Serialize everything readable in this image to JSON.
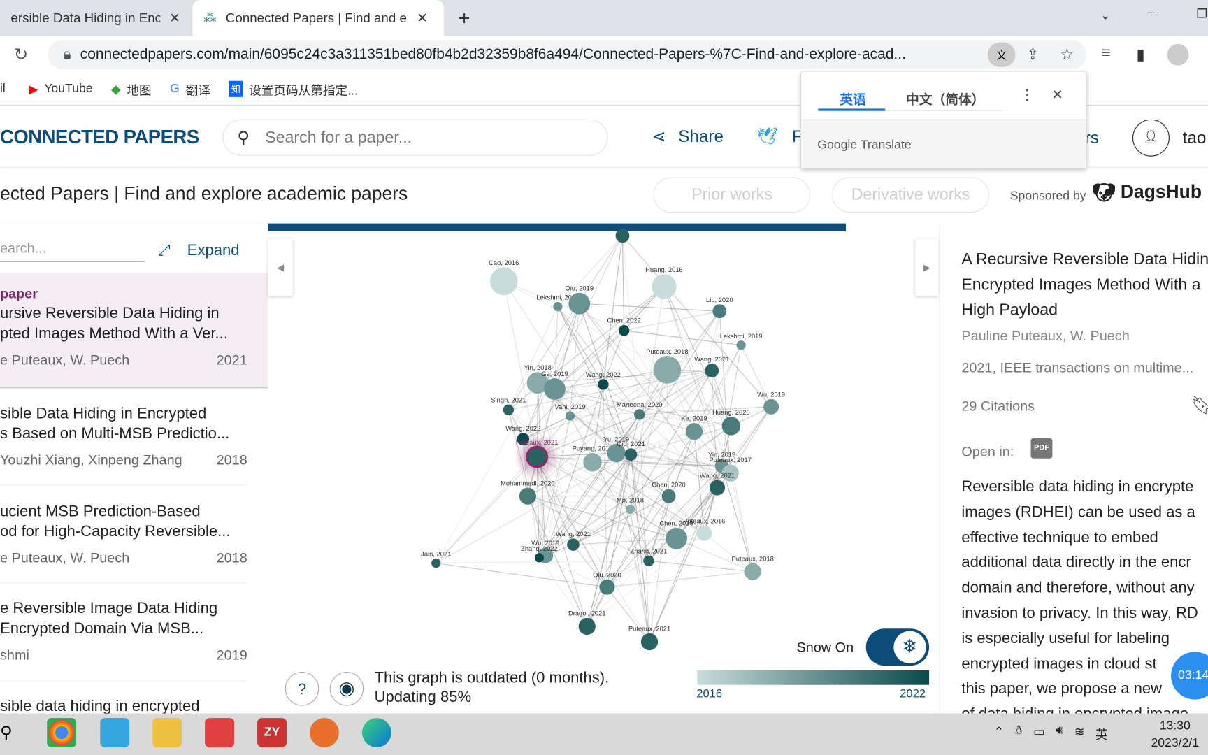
{
  "browser": {
    "tabs": [
      {
        "label": "ersible Data Hiding in Encr"
      },
      {
        "label": "Connected Papers | Find and e"
      }
    ],
    "url": "connectedpapers.com/main/6095c24c3a311351bed80fb4b2d32359b8f6a494/Connected-Papers-%7C-Find-and-explore-acad...",
    "bookmarks": [
      "il",
      "YouTube",
      "地图",
      "翻译",
      "设置页码从第指定..."
    ]
  },
  "translate_popup": {
    "tabs": [
      "英语",
      "中文（简体）"
    ],
    "brand": "Google Translate"
  },
  "header": {
    "logo": "CONNECTED PAPERS",
    "search_placeholder": "Search for a paper...",
    "share": "Share",
    "follow": "F",
    "rs": "rs",
    "user": "tao"
  },
  "subheader": {
    "title": "ected Papers | Find and explore academic papers",
    "prior": "Prior works",
    "derivative": "Derivative works",
    "sponsored": "Sponsored by",
    "sponsor": "DagsHub"
  },
  "left": {
    "search_placeholder": "earch...",
    "expand": "Expand",
    "origin_label": "paper",
    "items": [
      {
        "title1": "ursive Reversible Data Hiding in",
        "title2": "pted Images Method With a Ver...",
        "authors": "e Puteaux, W. Puech",
        "year": "2021"
      },
      {
        "title1": "sible Data Hiding in Encrypted",
        "title2": "s Based on Multi-MSB Predictio...",
        "authors": "Youzhi Xiang, Xinpeng Zhang",
        "year": "2018"
      },
      {
        "title1": "ucient MSB Prediction-Based",
        "title2": "od for High-Capacity Reversible...",
        "authors": "e Puteaux, W. Puech",
        "year": "2018"
      },
      {
        "title1": "e Reversible Image Data Hiding",
        "title2": "Encrypted Domain Via MSB...",
        "authors": "shmi",
        "year": "2019"
      },
      {
        "title1": "sible data hiding in encrypted",
        "title2": "",
        "authors": "",
        "year": ""
      }
    ]
  },
  "graph": {
    "nodes": [
      "",
      "Cao, 2016",
      "Huang, 2016",
      "Lekshmi, 2019",
      "Qiu, 2019",
      "Liu, 2020",
      "Chen, 2022",
      "Lekshmi, 2019",
      "Puteaux, 2018",
      "Wang, 2021",
      "Yin, 2018",
      "Ge, 2019",
      "Wang, 2022",
      "Wu, 2019",
      "Singh, 2021",
      "Vani, 2019",
      "Marteena, 2020",
      "Ke, 2019",
      "Huang, 2020",
      "Wang, 2022",
      "Puteaux, 2021",
      "Puyang, 2018",
      "Yu, 2019",
      "Qiu, 2021",
      "Yin, 2019",
      "Puteaux, 2017",
      "Wang, 2021",
      "Mohammadi, 2020",
      "Chen, 2020",
      "Mp, 2018",
      "Puteaux, 2016",
      "Chen, 2019",
      "Wang, 2021",
      "Wu, 2019",
      "Zhang, 2022",
      "Zhang, 2021",
      "Jain, 2021",
      "Puteaux, 2018",
      "Qiu, 2020",
      "Dragoi, 2021",
      "Puteaux, 2021"
    ],
    "snow": "Snow On",
    "snow_on": true,
    "status1": "This graph is outdated (0 months).",
    "status2": "Updating 85%",
    "progress_percent": 85,
    "legend_min": "2016",
    "legend_max": "2022",
    "colors": {
      "old": "#c9dcdc",
      "new": "#0a4a4a",
      "accent": "#0e4c7a",
      "selected": "#8a2a6a"
    }
  },
  "detail": {
    "title": [
      "A Recursive Reversible Data Hidin",
      "Encrypted Images Method With a",
      "High Payload"
    ],
    "authors": "Pauline Puteaux, W. Puech",
    "venue": "2021, IEEE transactions on multime...",
    "citations": "29 Citations",
    "open_in": "Open in:",
    "pdf": "PDF",
    "abstract": [
      "Reversible data hiding in encrypte",
      "images (RDHEI) can be used as a",
      "effective technique to embed",
      "additional data directly in the encr",
      "domain and therefore, without any",
      "invasion to privacy. In this way, RD",
      "is especially useful for labeling",
      "encrypted images in cloud st",
      "this paper, we propose a new",
      "of data hiding in encrypted image"
    ]
  },
  "timer": "03:14",
  "taskbar": {
    "time": "13:30",
    "date": "2023/2/1",
    "ime": "英"
  }
}
